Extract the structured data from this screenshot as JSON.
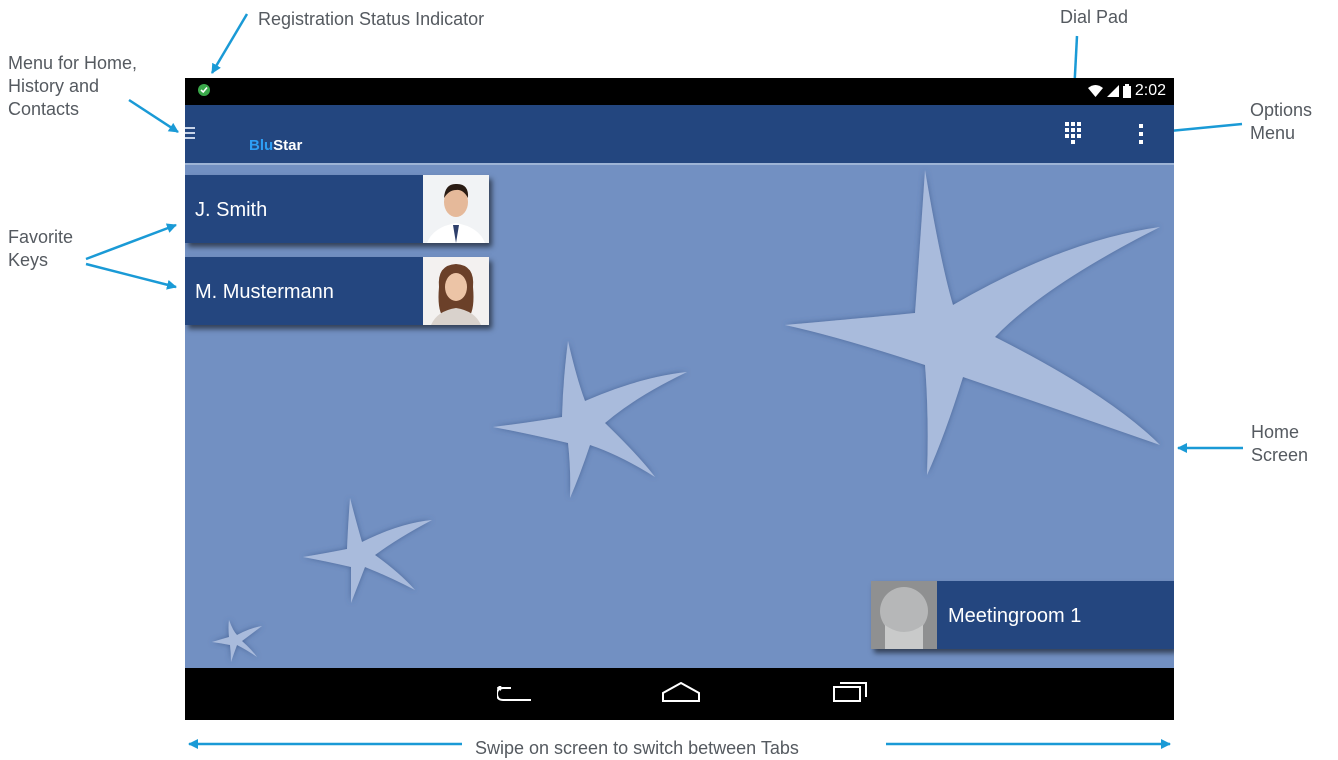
{
  "callouts": {
    "registration": "Registration Status Indicator",
    "dial_pad": "Dial Pad",
    "menu": [
      "Menu for Home,",
      "History and",
      "Contacts"
    ],
    "options": [
      "Options",
      "Menu"
    ],
    "favorite": [
      "Favorite",
      "Keys"
    ],
    "home": [
      "Home",
      "Screen"
    ],
    "swipe": "Swipe on screen to switch between Tabs"
  },
  "statusbar": {
    "time": "2:02",
    "registration_status": "registered"
  },
  "app": {
    "logo_blu": "Blu",
    "logo_star": "Star"
  },
  "favorites": [
    {
      "name": "J. Smith"
    },
    {
      "name": "M. Mustermann"
    },
    {
      "name": "Meetingroom 1"
    }
  ],
  "icons": [
    "menu-icon",
    "dialpad-icon",
    "overflow-menu-icon",
    "wifi-icon",
    "signal-icon",
    "battery-icon",
    "back-icon",
    "home-icon",
    "recents-icon",
    "avatar-placeholder-icon"
  ],
  "colors": {
    "actionbar": "#23467f",
    "home_bg": "#7290c2",
    "arrow": "#1a9ad6",
    "favorite_key": "#24467f"
  }
}
